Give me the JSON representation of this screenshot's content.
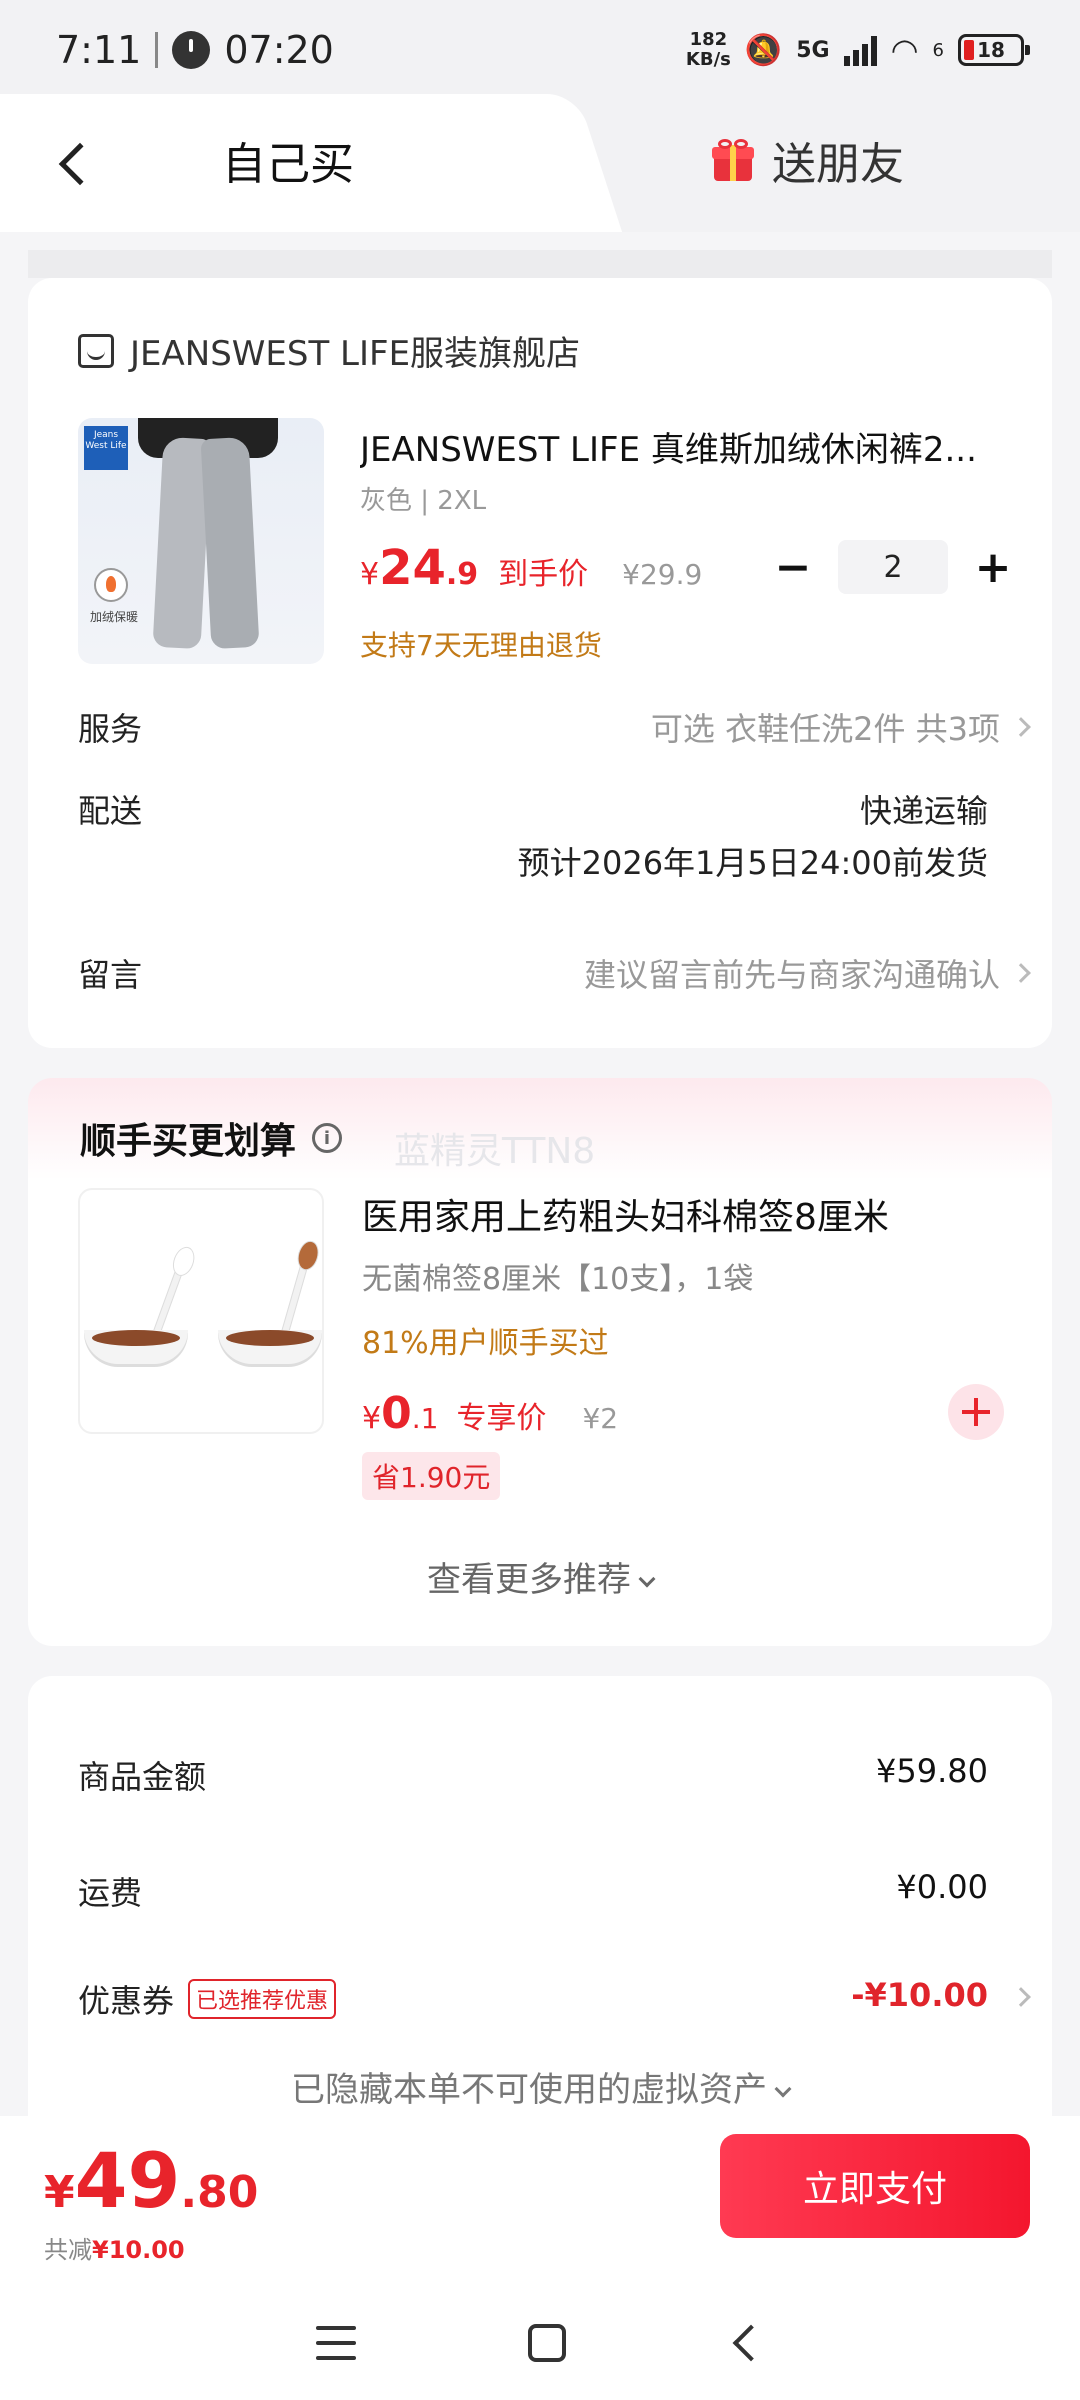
{
  "status_bar": {
    "time": "7:11",
    "clock_time": "07:20",
    "speed_value": "182",
    "speed_unit": "KB/s",
    "network": "5G",
    "wifi_level": "6",
    "battery": "18"
  },
  "tabs": {
    "self_buy": "自己买",
    "gift_friend": "送朋友"
  },
  "order": {
    "store_name": "JEANSWEST LIFE服装旗舰店",
    "product_image_brand": "Jeans West Life",
    "product_image_badge": "加绒保暖",
    "product_title": "JEANSWEST LIFE 真维斯加绒休闲裤2...",
    "product_spec": "灰色 | 2XL",
    "price_yen": "¥",
    "price_int": "24",
    "price_dec": ".9",
    "price_tag": "到手价",
    "orig_price": "¥29.9",
    "quantity": "2",
    "return_policy": "支持7天无理由退货",
    "service_label": "服务",
    "service_value": "可选 衣鞋任洗2件 共3项",
    "delivery_label": "配送",
    "delivery_method": "快递运输",
    "delivery_eta": "预计2026年1月5日24:00前发货",
    "message_label": "留言",
    "message_placeholder": "建议留言前先与商家沟通确认"
  },
  "addon": {
    "title": "顺手买更划算",
    "watermark": "蓝精灵TTN8",
    "item_title": "医用家用上药粗头妇科棉签8厘米",
    "item_spec": "无菌棉签8厘米【10支】，1袋",
    "item_social": "81%用户顺手买过",
    "price_yen": "¥",
    "price_int": "0",
    "price_dec": ".1",
    "price_tag": "专享价",
    "orig_price": "¥2",
    "save_badge": "省1.90元",
    "more_reco": "查看更多推荐"
  },
  "summary": {
    "goods_label": "商品金额",
    "goods_value": "¥59.80",
    "shipping_label": "运费",
    "shipping_value": "¥0.00",
    "coupon_label": "优惠券",
    "coupon_badge": "已选推荐优惠",
    "coupon_value": "-¥10.00",
    "hidden_assets": "已隐藏本单不可使用的虚拟资产"
  },
  "paybar": {
    "total_yen": "¥",
    "total_int": "49",
    "total_dec": ".80",
    "saved_label": "共减",
    "saved_value": "¥10.00",
    "pay_button": "立即支付"
  },
  "colors": {
    "accent": "#e8242b",
    "gold": "#c27a17"
  }
}
